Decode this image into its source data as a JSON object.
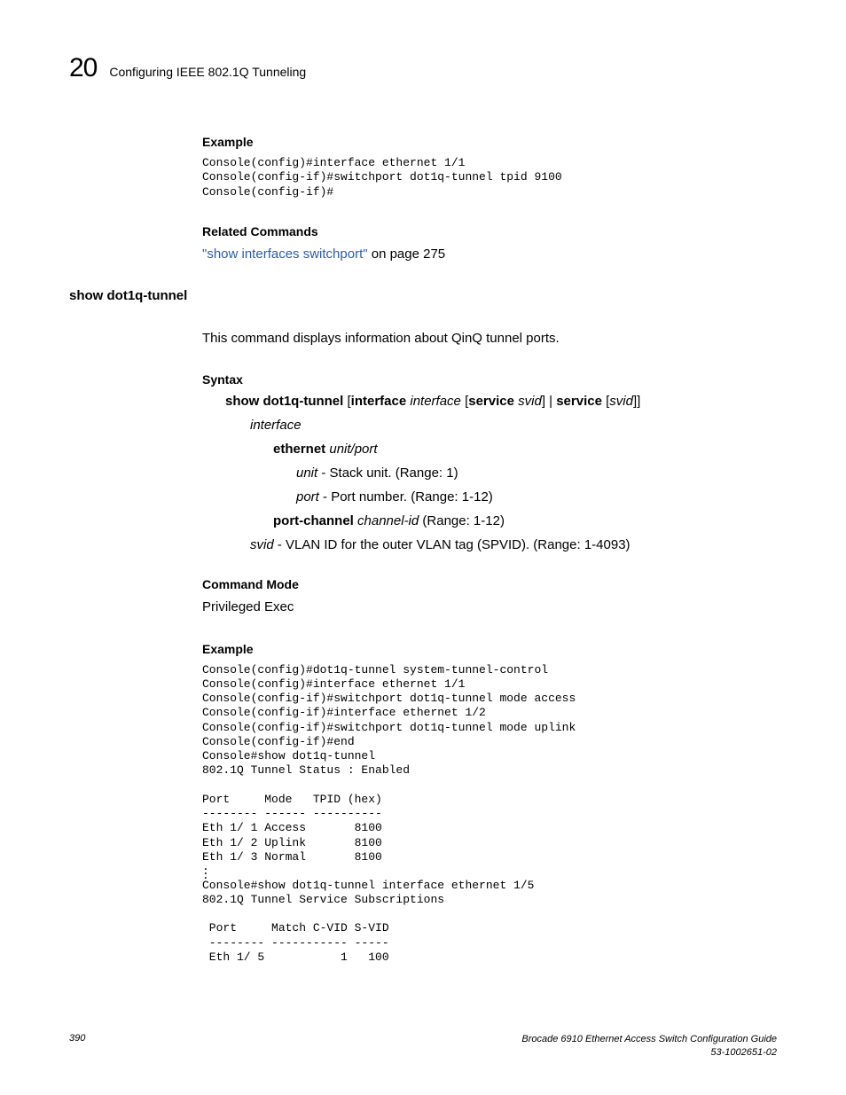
{
  "header": {
    "chapnum": "20",
    "chaptitle": "Configuring IEEE 802.1Q Tunneling"
  },
  "ex1": {
    "heading": "Example",
    "code": "Console(config)#interface ethernet 1/1\nConsole(config-if)#switchport dot1q-tunnel tpid 9100\nConsole(config-if)#"
  },
  "rel": {
    "heading": "Related Commands",
    "linktext": "\"show interfaces switchport\"",
    "rest": " on page 275"
  },
  "cmd": {
    "name": "show dot1q-tunnel",
    "desc": "This command displays information about QinQ tunnel ports."
  },
  "syntax": {
    "heading": "Syntax",
    "line": {
      "p1": "show dot1q-tunnel",
      "p2": " [",
      "p3": "interface",
      "p4": " interface ",
      "p5": "[",
      "p6": "service",
      "p7": " svid",
      "p8": "] | ",
      "p9": "service",
      "p10": " [",
      "p11": "svid",
      "p12": "]]"
    },
    "interface_lbl": "interface",
    "eth": {
      "b": "ethernet",
      "i": " unit/port"
    },
    "unit": {
      "i": "unit",
      "r": " - Stack unit. (Range: 1)"
    },
    "port": {
      "i": "port",
      "r": " - Port number. (Range: 1-12)"
    },
    "pc": {
      "b": "port-channel",
      "i": " channel-id",
      "r": " (Range: 1-12)"
    },
    "svid": {
      "i": "svid",
      "r": " - VLAN ID for the outer VLAN tag (SPVID). (Range: 1-4093)"
    }
  },
  "mode": {
    "heading": "Command Mode",
    "text": "Privileged Exec"
  },
  "ex2": {
    "heading": "Example",
    "code1": "Console(config)#dot1q-tunnel system-tunnel-control\nConsole(config)#interface ethernet 1/1\nConsole(config-if)#switchport dot1q-tunnel mode access\nConsole(config-if)#interface ethernet 1/2\nConsole(config-if)#switchport dot1q-tunnel mode uplink\nConsole(config-if)#end\nConsole#show dot1q-tunnel\n802.1Q Tunnel Status : Enabled\n\nPort     Mode   TPID (hex)\n-------- ------ ----------\nEth 1/ 1 Access       8100\nEth 1/ 2 Uplink       8100\nEth 1/ 3 Normal       8100",
    "ellipsis": ".\n.\n.",
    "code2": "Console#show dot1q-tunnel interface ethernet 1/5\n802.1Q Tunnel Service Subscriptions\n\n Port     Match C-VID S-VID\n -------- ----------- -----\n Eth 1/ 5           1   100"
  },
  "footer": {
    "page": "390",
    "title": "Brocade 6910 Ethernet Access Switch Configuration Guide",
    "docnum": "53-1002651-02"
  }
}
